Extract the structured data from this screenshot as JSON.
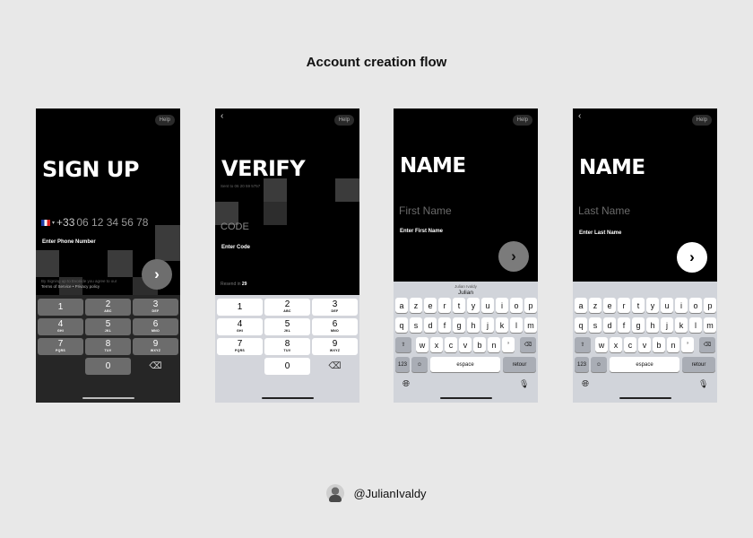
{
  "page": {
    "title": "Account creation flow"
  },
  "screens": [
    {
      "help": "Help",
      "heading": "SIGN UP",
      "phone": {
        "country_code": "+33",
        "placeholder": "06 12 34 56 78"
      },
      "label": "Enter Phone Number",
      "terms": "By Signing up to Evonide you agree to our",
      "terms_links": "Terms of Service • Privacy policy",
      "keypad": [
        {
          "n": "1",
          "l": ""
        },
        {
          "n": "2",
          "l": "ABC"
        },
        {
          "n": "3",
          "l": "DEF"
        },
        {
          "n": "4",
          "l": "GHI"
        },
        {
          "n": "5",
          "l": "JKL"
        },
        {
          "n": "6",
          "l": "MNO"
        },
        {
          "n": "7",
          "l": "PQRS"
        },
        {
          "n": "8",
          "l": "TUV"
        },
        {
          "n": "9",
          "l": "WXYZ"
        },
        {
          "n": "0",
          "l": ""
        }
      ]
    },
    {
      "help": "Help",
      "heading": "VERIFY",
      "sent_to": "Sent to 06 20 59 5757",
      "code_placeholder": "CODE",
      "label": "Enter Code",
      "resend_prefix": "Resend in",
      "resend_seconds": "29",
      "keypad": [
        {
          "n": "1",
          "l": ""
        },
        {
          "n": "2",
          "l": "ABC"
        },
        {
          "n": "3",
          "l": "DEF"
        },
        {
          "n": "4",
          "l": "GHI"
        },
        {
          "n": "5",
          "l": "JKL"
        },
        {
          "n": "6",
          "l": "MNO"
        },
        {
          "n": "7",
          "l": "PQRS"
        },
        {
          "n": "8",
          "l": "TUV"
        },
        {
          "n": "9",
          "l": "WXYZ"
        },
        {
          "n": "0",
          "l": ""
        }
      ]
    },
    {
      "help": "Help",
      "heading": "NAME",
      "field_placeholder": "First Name",
      "label": "Enter First Name",
      "suggestion_top": "Julian Ivaldy",
      "suggestion_main": "Julian"
    },
    {
      "help": "Help",
      "heading": "NAME",
      "field_placeholder": "Last Name",
      "label": "Enter Last Name"
    }
  ],
  "keyboard": {
    "row1": [
      "a",
      "z",
      "e",
      "r",
      "t",
      "y",
      "u",
      "i",
      "o",
      "p"
    ],
    "row2": [
      "q",
      "s",
      "d",
      "f",
      "g",
      "h",
      "j",
      "k",
      "l",
      "m"
    ],
    "row3": [
      "w",
      "x",
      "c",
      "v",
      "b",
      "n",
      "’"
    ],
    "numbers_key": "123",
    "space_label": "espace",
    "return_label": "retour"
  },
  "icons": {
    "back": "chevron-left-icon",
    "next": "chevron-right-icon",
    "delete": "backspace-icon",
    "shift": "shift-icon",
    "emoji": "emoji-icon",
    "globe": "globe-icon",
    "mic": "microphone-icon"
  },
  "credit": {
    "handle": "@JulianIvaldy"
  }
}
